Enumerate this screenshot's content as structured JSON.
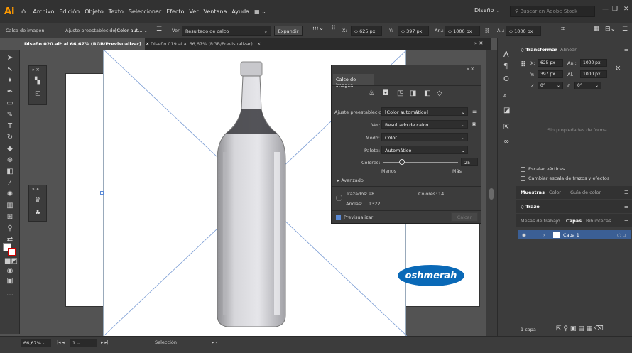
{
  "menubar": {
    "logo": "Ai",
    "items": [
      "Archivo",
      "Edición",
      "Objeto",
      "Texto",
      "Seleccionar",
      "Efecto",
      "Ver",
      "Ventana",
      "Ayuda"
    ],
    "workspace": "Diseño",
    "search_placeholder": "Buscar en Adobe Stock"
  },
  "control_bar": {
    "label": "Calco de imagen",
    "preset_label": "Ajuste preestablecido:",
    "preset_value": "[Color aut...",
    "view_label": "Ver:",
    "view_value": "Resultado de calco",
    "expand_button": "Expandir",
    "x_label": "X:",
    "x_value": "625 px",
    "y_label": "Y:",
    "y_value": "397 px",
    "w_label": "An.:",
    "w_value": "1000 px",
    "h_label": "Al.:",
    "h_value": "1000 px"
  },
  "tabs": [
    {
      "label": "Diseño 020.ai* al 66,67% (RGB/Previsualizar)",
      "active": true
    },
    {
      "label": "Diseño 019.ai al 66,67% (RGB/Previsualizar)",
      "active": false
    }
  ],
  "trace_panel": {
    "title": "Calco de imagen",
    "preset_label": "Ajuste preestablecido:",
    "preset_value": "[Color automático]",
    "view_label": "Ver:",
    "view_value": "Resultado de calco",
    "mode_label": "Modo:",
    "mode_value": "Color",
    "palette_label": "Paleta:",
    "palette_value": "Automático",
    "colors_label": "Colores:",
    "colors_value": "25",
    "colors_fraction": 0.25,
    "less_label": "Menos",
    "more_label": "Más",
    "advanced_label": "Avanzado",
    "paths_label": "Trazados:",
    "paths_value": "98",
    "colors_count_label": "Colores:",
    "colors_count_value": "14",
    "anchors_label": "Anclas:",
    "anchors_value": "1322",
    "preview_label": "Previsualizar",
    "trace_button": "Calcar"
  },
  "artwork": {
    "brand_text": "oshmerah"
  },
  "right_panel": {
    "transform_tab": "Transformar",
    "align_tab": "Alinear",
    "x_label": "X:",
    "x_value": "625 px",
    "y_label": "Y:",
    "y_value": "397 px",
    "w_label": "An.:",
    "w_value": "1000 px",
    "h_label": "Al.:",
    "h_value": "1000 px",
    "angle_value": "0°",
    "shear_value": "0°",
    "no_shape_props": "Sin propiedades de forma",
    "scale_corners": "Escalar vértices",
    "scale_strokes": "Cambiar escala de trazos y efectos",
    "swatch_tabs": [
      "Muestras",
      "Color",
      "Guía de color"
    ],
    "stroke_tab": "Trazo",
    "layer_tabs": [
      "Mesas de trabajo",
      "Capas",
      "Bibliotecas"
    ],
    "layer_name": "Capa 1",
    "layer_count": "1 capa"
  },
  "status_bar": {
    "zoom": "66,67%",
    "artboard_num": "1",
    "tool_name": "Selección"
  },
  "colors": {
    "accent": "#ff9a00",
    "layer_highlight": "#3b5f95",
    "brand_blue": "#0a69b7"
  }
}
